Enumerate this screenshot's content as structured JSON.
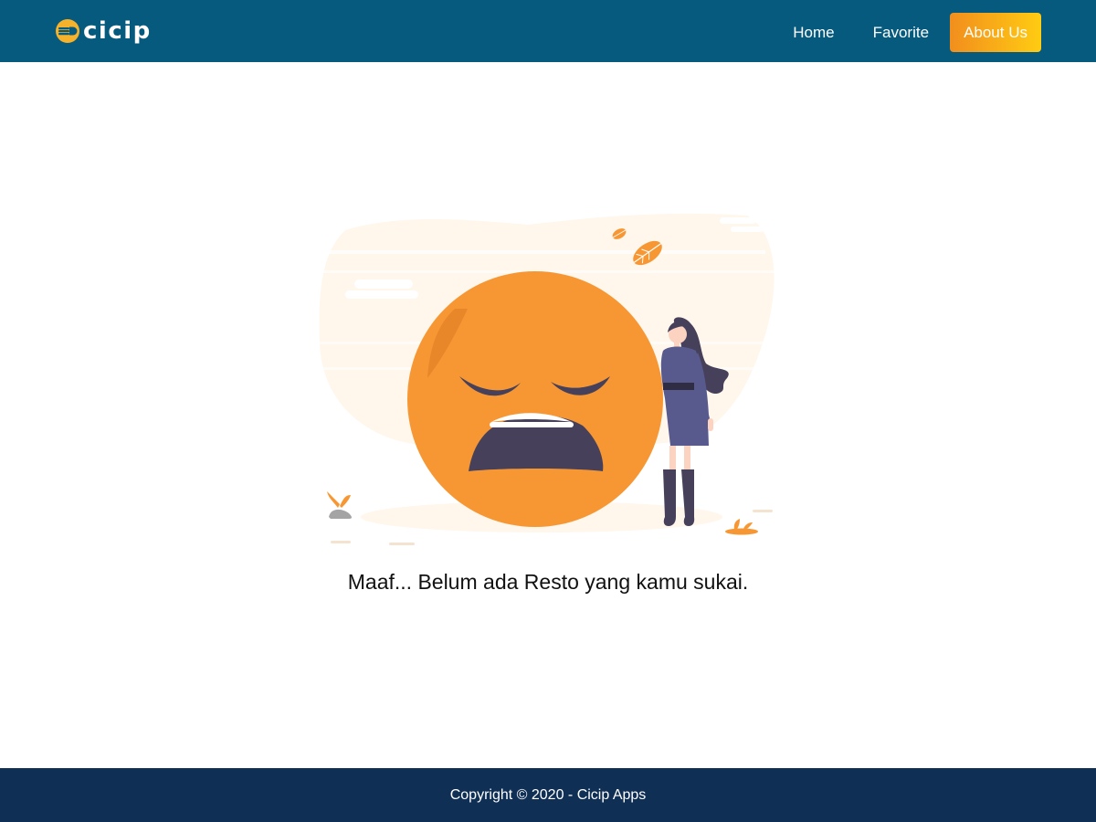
{
  "header": {
    "brand": "cicip",
    "nav": [
      {
        "label": "Home"
      },
      {
        "label": "Favorite"
      },
      {
        "label": "About Us"
      }
    ]
  },
  "main": {
    "empty_message": "Maaf... Belum ada Resto yang kamu sukai."
  },
  "footer": {
    "copyright": "Copyright © 2020 - Cicip Apps"
  },
  "colors": {
    "navbar": "#065a7e",
    "footer": "#102f55",
    "accent_start": "#f28e1d",
    "accent_end": "#ffcc12",
    "illustration_orange": "#f79733",
    "illustration_dark": "#46405a",
    "dress": "#585a8e"
  }
}
